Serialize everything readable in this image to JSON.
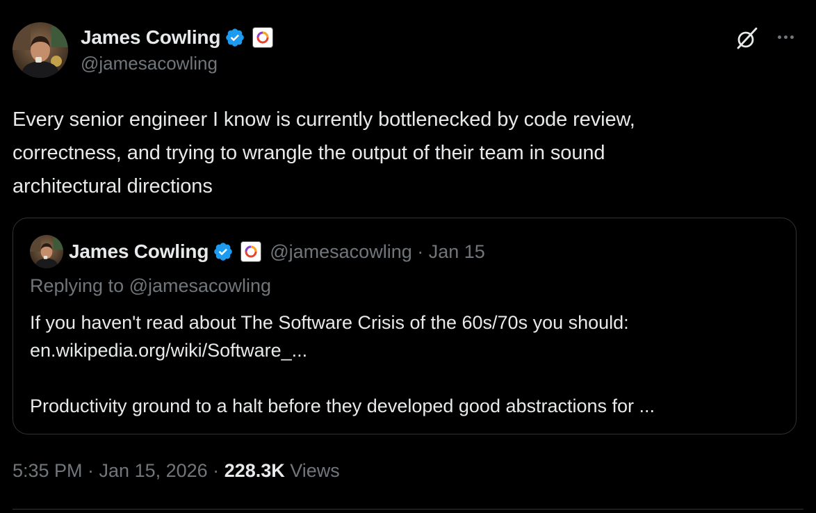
{
  "author": {
    "display_name": "James Cowling",
    "handle": "@jamesacowling",
    "verified_icon": "verified-badge-icon",
    "affiliation_icon": "affiliation-logo-icon",
    "colors": {
      "verified": "#1d9bf0",
      "name": "#e7e9ea",
      "muted": "#71767b"
    }
  },
  "header": {
    "grok_icon": "grok-icon",
    "more_icon": "more-options-icon"
  },
  "tweet": {
    "lines": [
      "Every senior engineer I know is currently bottlenecked by code review,",
      "correctness, and trying to wrangle the output of their team in sound",
      "architectural directions"
    ]
  },
  "quote": {
    "display_name": "James Cowling",
    "meta": "@jamesacowling · Jan 15",
    "replying": "Replying to @jamesacowling",
    "body": {
      "line1": "If you haven't read about The Software Crisis of the 60s/70s you should:",
      "line2": "en.wikipedia.org/wiki/Software_...",
      "line3": "Productivity ground to a halt before they developed good abstractions for ..."
    }
  },
  "footer": {
    "timestamp": "5:35 PM · Jan 15, 2026 · ",
    "views_count": "228.3K",
    "views_label": " Views"
  }
}
